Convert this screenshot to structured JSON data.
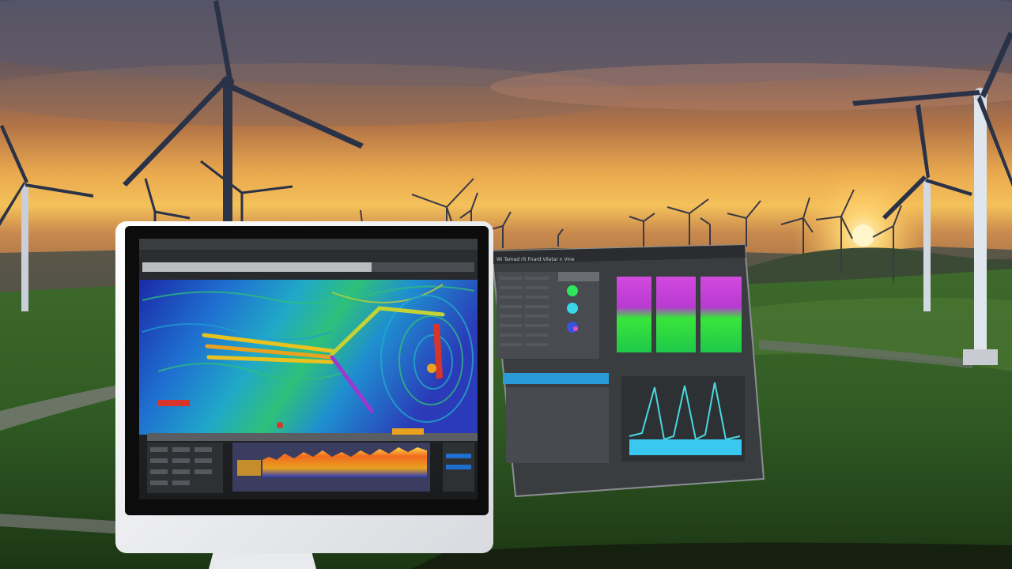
{
  "scene": {
    "description_colors": {
      "sky_top": "#4a4a5e",
      "sky_mid": "#a06a48",
      "sky_glow": "#f6c25a",
      "sun": "#fff2b0",
      "grass": "#2f5a23",
      "grass_dark": "#1b3512",
      "hill": "#3d4a3a",
      "turbine": "#dfe6ee",
      "turbine_shadow": "#2a3040",
      "monitor_bezel": "#0c0c0c",
      "monitor_frame": "#f1f2f4",
      "panel_bg": "#3a3d40"
    }
  },
  "monitor": {
    "heatmap_colors": [
      "#1a2aa8",
      "#1f6fd0",
      "#20a8c8",
      "#2ec07a",
      "#c4d233",
      "#e9a21f",
      "#d8352a"
    ]
  },
  "floating_panel": {
    "title": "Wi Tamad rlt Fnard Vilatar n Vine",
    "spectral_colors": [
      "#c238d6",
      "#2ee63a",
      "#f04ac8",
      "#38c8f0"
    ],
    "line_chart": {
      "peaks": [
        0.15,
        0.9,
        0.2,
        0.95,
        0.25,
        0.92,
        0.15
      ]
    }
  }
}
